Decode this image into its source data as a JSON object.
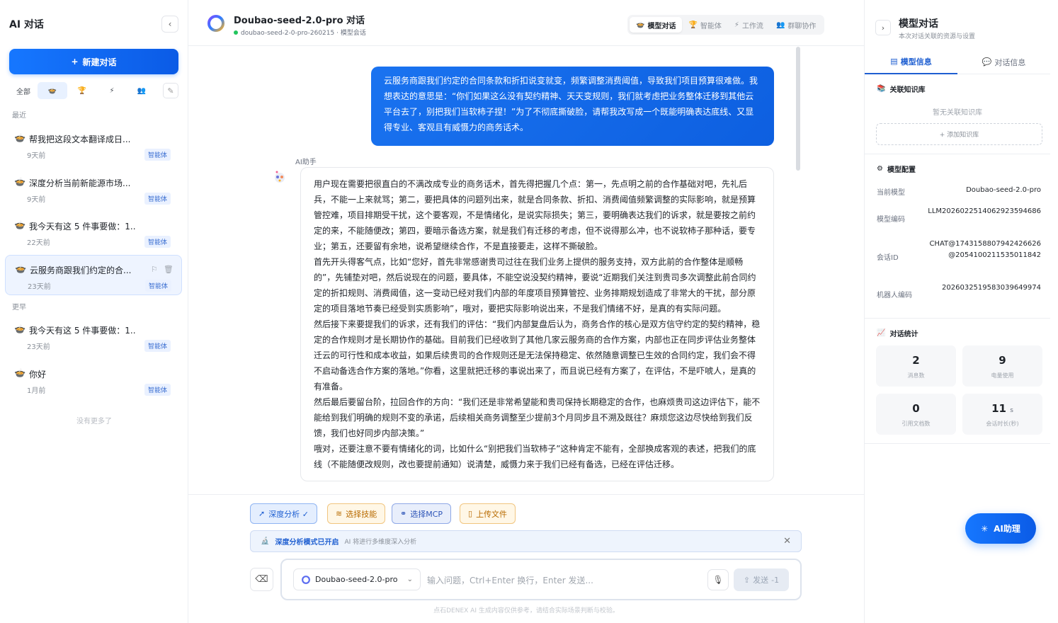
{
  "sidebar": {
    "title": "AI 对话",
    "collapse_icon": "‹",
    "new_chat_label": "新建对话",
    "filters": {
      "all": "全部",
      "icons": [
        "🍲",
        "🏆",
        "⚡",
        "👥"
      ]
    },
    "section_recent": "最近",
    "section_earlier": "更早",
    "items": [
      {
        "title": "帮我把这段文本翻译成日...",
        "time": "9天前",
        "badge": "智能体"
      },
      {
        "title": "深度分析当前新能源市场...",
        "time": "9天前",
        "badge": "智能体"
      },
      {
        "title": "我今天有这 5 件事要做：1...",
        "time": "22天前",
        "badge": "智能体"
      },
      {
        "title": "云服务商跟我们约定的合...",
        "time": "23天前",
        "badge": "智能体"
      },
      {
        "title": "我今天有这 5 件事要做：1...",
        "time": "23天前",
        "badge": "智能体"
      },
      {
        "title": "你好",
        "time": "1月前",
        "badge": "智能体"
      }
    ],
    "no_more": "没有更多了"
  },
  "header": {
    "title": "Doubao-seed-2.0-pro 对话",
    "subtitle": "doubao-seed-2-0-pro-260215 · 模型会话",
    "tabs": [
      {
        "icon": "🍲",
        "label": "模型对话"
      },
      {
        "icon": "🏆",
        "label": "智能体"
      },
      {
        "icon": "⚡",
        "label": "工作流"
      },
      {
        "icon": "👥",
        "label": "群聊协作"
      }
    ]
  },
  "chat": {
    "user_message": "云服务商跟我们约定的合同条款和折扣说变就变，频繁调整消费阈值，导致我们项目预算很难做。我想表达的意思是：“你们如果这么没有契约精神、天天变规则，我们就考虑把业务整体迁移到其他云平台去了，别把我们当软柿子捏！”为了不彻底撕破脸，请帮我改写成一个既能明确表达底线、又显得专业、客观且有威慑力的商务话术。",
    "ai_label": "AI助手",
    "ai_paragraphs": [
      "用户现在需要把很直白的不满改成专业的商务话术，首先得把握几个点：第一，先点明之前的合作基础对吧，先礼后兵，不能一上来就骂；第二，要把具体的问题列出来，就是合同条款、折扣、消费阈值频繁调整的实际影响，就是预算管控难，项目排期受干扰，这个要客观，不是情绪化，是说实际损失；第三，要明确表达我们的诉求，就是要按之前约定的来，不能随便改；第四，要暗示备选方案，就是我们有迁移的考虑，但不说得那么冲，也不说软柿子那种话，要专业；第五，还要留有余地，说希望继续合作，不是直接要走，这样不撕破脸。",
      "首先开头得客气点，比如“您好，首先非常感谢贵司过往在我们业务上提供的服务支持，双方此前的合作整体是顺畅的”，先铺垫对吧，然后说现在的问题，要具体，不能空说没契约精神，要说“近期我们关注到贵司多次调整此前合同约定的折扣规则、消费阈值，这一变动已经对我们内部的年度项目预算管控、业务排期规划造成了非常大的干扰，部分原定的项目落地节奏已经受到实质影响”，哦对，要把实际影响说出来，不是我们情绪不好，是真的有实际问题。",
      "然后接下来要提我们的诉求，还有我们的评估：“我们内部复盘后认为，商务合作的核心是双方信守约定的契约精神，稳定的合作规则才是长期协作的基础。目前我们已经收到了其他几家云服务商的合作方案，内部也正在同步评估业务整体迁云的可行性和成本收益，如果后续贵司的合作规则还是无法保持稳定、依然随意调整已生效的合同约定，我们会不得不启动备选合作方案的落地。”你看，这里就把迁移的事说出来了，而且说已经有方案了，在评估，不是吓唬人，是真的有准备。",
      "然后最后要留台阶，拉回合作的方向：“我们还是非常希望能和贵司保持长期稳定的合作，也麻烦贵司这边评估下，能不能给到我们明确的规则不变的承诺，后续相关商务调整至少提前3个月同步且不溯及既往？麻烦您这边尽快给到我们反馈，我们也好同步内部决策。”",
      "哦对，还要注意不要有情绪化的词，比如什么“别把我们当软柿子”这种肯定不能有，全部换成客观的表述，把我们的底线（不能随便改规则，改也要提前通知）说清楚，威慑力来于我们已经有备选，已经在评估迁移。"
    ]
  },
  "composer": {
    "chips": {
      "deep": "深度分析 ✓",
      "skill": "选择技能",
      "mcp": "选择MCP",
      "upload": "上传文件"
    },
    "banner_title": "深度分析模式已开启",
    "banner_desc": "AI 将进行多维度深入分析",
    "model_name": "Doubao-seed-2.0-pro",
    "placeholder": "输入问题，Ctrl+Enter 换行，Enter 发送...",
    "send_label": "发送",
    "send_cost": "-1",
    "footnote": "点石DENEX AI 生成内容仅供参考，请结合实际场景判断与校验。"
  },
  "right_panel": {
    "title": "模型对话",
    "subtitle": "本次对话关联的资源与设置",
    "tab_model": "模型信息",
    "tab_chat": "对话信息",
    "kb_title": "关联知识库",
    "kb_empty": "暂无关联知识库",
    "kb_add": "+ 添加知识库",
    "config_title": "模型配置",
    "config": [
      {
        "label": "当前模型",
        "value": "Doubao-seed-2.0-pro"
      },
      {
        "label": "模型编码",
        "value": "LLM2026022514062923594686"
      },
      {
        "label": "会话ID",
        "value": "CHAT@1743158807942426626@2054100211535011842"
      },
      {
        "label": "机器人编码",
        "value": "2026032519583039649974"
      }
    ],
    "stats_title": "对话统计",
    "stats": [
      {
        "value": "2",
        "unit": "",
        "label": "消息数"
      },
      {
        "value": "9",
        "unit": "",
        "label": "电量使用"
      },
      {
        "value": "0",
        "unit": "",
        "label": "引用文档数"
      },
      {
        "value": "11",
        "unit": "s",
        "label": "会话时长(秒)"
      }
    ]
  },
  "ai_assistant_label": "AI助理",
  "colors": {
    "primary": "#1677ff",
    "badge": "#3b6fd1",
    "online": "#22c55e"
  }
}
